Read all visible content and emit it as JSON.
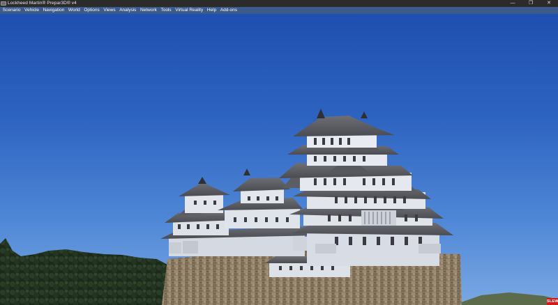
{
  "window": {
    "title": "Lockheed Martin® Prepar3D® v4",
    "controls": {
      "minimize": "—",
      "restore": "❐",
      "close": "✕"
    }
  },
  "menu": {
    "items": [
      {
        "id": "scenario",
        "label": "Scenario"
      },
      {
        "id": "vehicle",
        "label": "Vehicle"
      },
      {
        "id": "navigation",
        "label": "Navigation"
      },
      {
        "id": "world",
        "label": "World"
      },
      {
        "id": "options",
        "label": "Options"
      },
      {
        "id": "views",
        "label": "Views"
      },
      {
        "id": "analysis",
        "label": "Analysis"
      },
      {
        "id": "network",
        "label": "Network"
      },
      {
        "id": "tools",
        "label": "Tools"
      },
      {
        "id": "virtual-reality",
        "label": "Virtual Reality"
      },
      {
        "id": "help",
        "label": "Help"
      },
      {
        "id": "add-ons",
        "label": "Add-ons"
      }
    ]
  },
  "status": {
    "slew": "SLEW"
  },
  "colors": {
    "titlebar": "#2b2b2b",
    "menubar": "#3c5a8a",
    "sky_top": "#1f4fb0",
    "sky_bottom": "#7aa8e2",
    "slew_badge": "#d11a1a"
  },
  "icons": {
    "app": "prepar3d-app-icon"
  }
}
